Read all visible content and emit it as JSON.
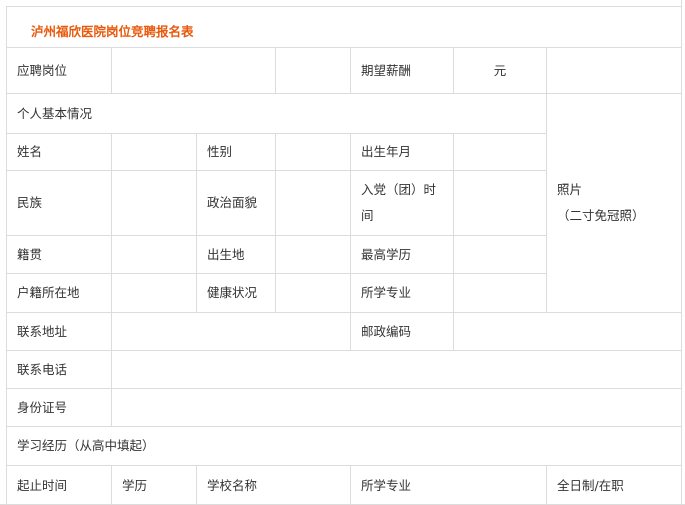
{
  "title": "泸州福欣医院岗位竞聘报名表",
  "row_apply": {
    "position_label": "应聘岗位",
    "salary_label": "期望薪酬",
    "salary_unit": "元"
  },
  "section_personal": "个人基本情况",
  "photo": {
    "label": "照片",
    "note": "（二寸免冠照）"
  },
  "personal": {
    "name": "姓名",
    "gender": "性别",
    "birth": "出生年月",
    "ethnicity": "民族",
    "political": "政治面貌",
    "party_line1": "入党（团）时",
    "party_line2": "间",
    "native": "籍贯",
    "birthplace": "出生地",
    "education": "最高学历",
    "household": "户籍所在地",
    "health": "健康状况",
    "major": "所学专业"
  },
  "contact": {
    "address": "联系地址",
    "postcode": "邮政编码",
    "phone": "联系电话",
    "id_number": "身份证号"
  },
  "study": {
    "section": "学习经历（从高中填起）",
    "headers": [
      "起止时间",
      "学历",
      "学校名称",
      "所学专业",
      "全日制/在职"
    ]
  }
}
